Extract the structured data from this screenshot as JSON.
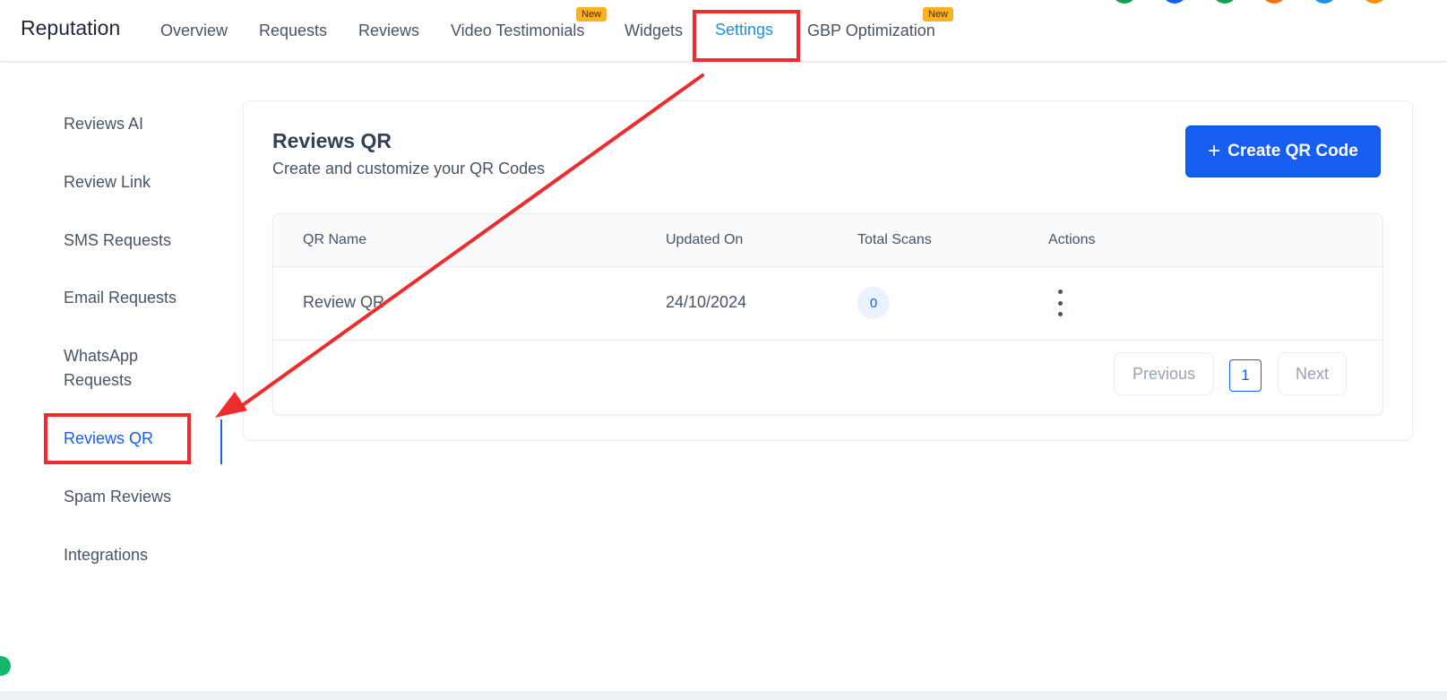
{
  "header": {
    "brand": "Reputation",
    "nav": [
      {
        "label": "Overview"
      },
      {
        "label": "Requests"
      },
      {
        "label": "Reviews"
      },
      {
        "label": "Video Testimonials",
        "badge": "New"
      },
      {
        "label": "Widgets"
      },
      {
        "label": "Settings",
        "active": true
      },
      {
        "label": "GBP Optimization",
        "badge": "New"
      }
    ]
  },
  "sidebar": {
    "items": [
      {
        "label": "Reviews AI"
      },
      {
        "label": "Review Link"
      },
      {
        "label": "SMS Requests"
      },
      {
        "label": "Email Requests"
      },
      {
        "label": "WhatsApp Requests"
      },
      {
        "label": "Reviews QR",
        "active": true
      },
      {
        "label": "Spam Reviews"
      },
      {
        "label": "Integrations"
      }
    ]
  },
  "main": {
    "title": "Reviews QR",
    "subtitle": "Create and customize your QR Codes",
    "create_button": "Create QR Code",
    "table": {
      "columns": [
        "QR Name",
        "Updated On",
        "Total Scans",
        "Actions"
      ],
      "rows": [
        {
          "name": "Review QR",
          "updated_on": "24/10/2024",
          "total_scans": "0"
        }
      ]
    },
    "pagination": {
      "previous": "Previous",
      "current_page": "1",
      "next": "Next"
    }
  },
  "colors": {
    "accent": "#155eef",
    "active_nav": "#1f8fe6",
    "annotation": "#ef2b2d",
    "badge": "#fdb022"
  },
  "icons": {
    "create": "plus-icon",
    "actions": "more-vertical-icon"
  }
}
